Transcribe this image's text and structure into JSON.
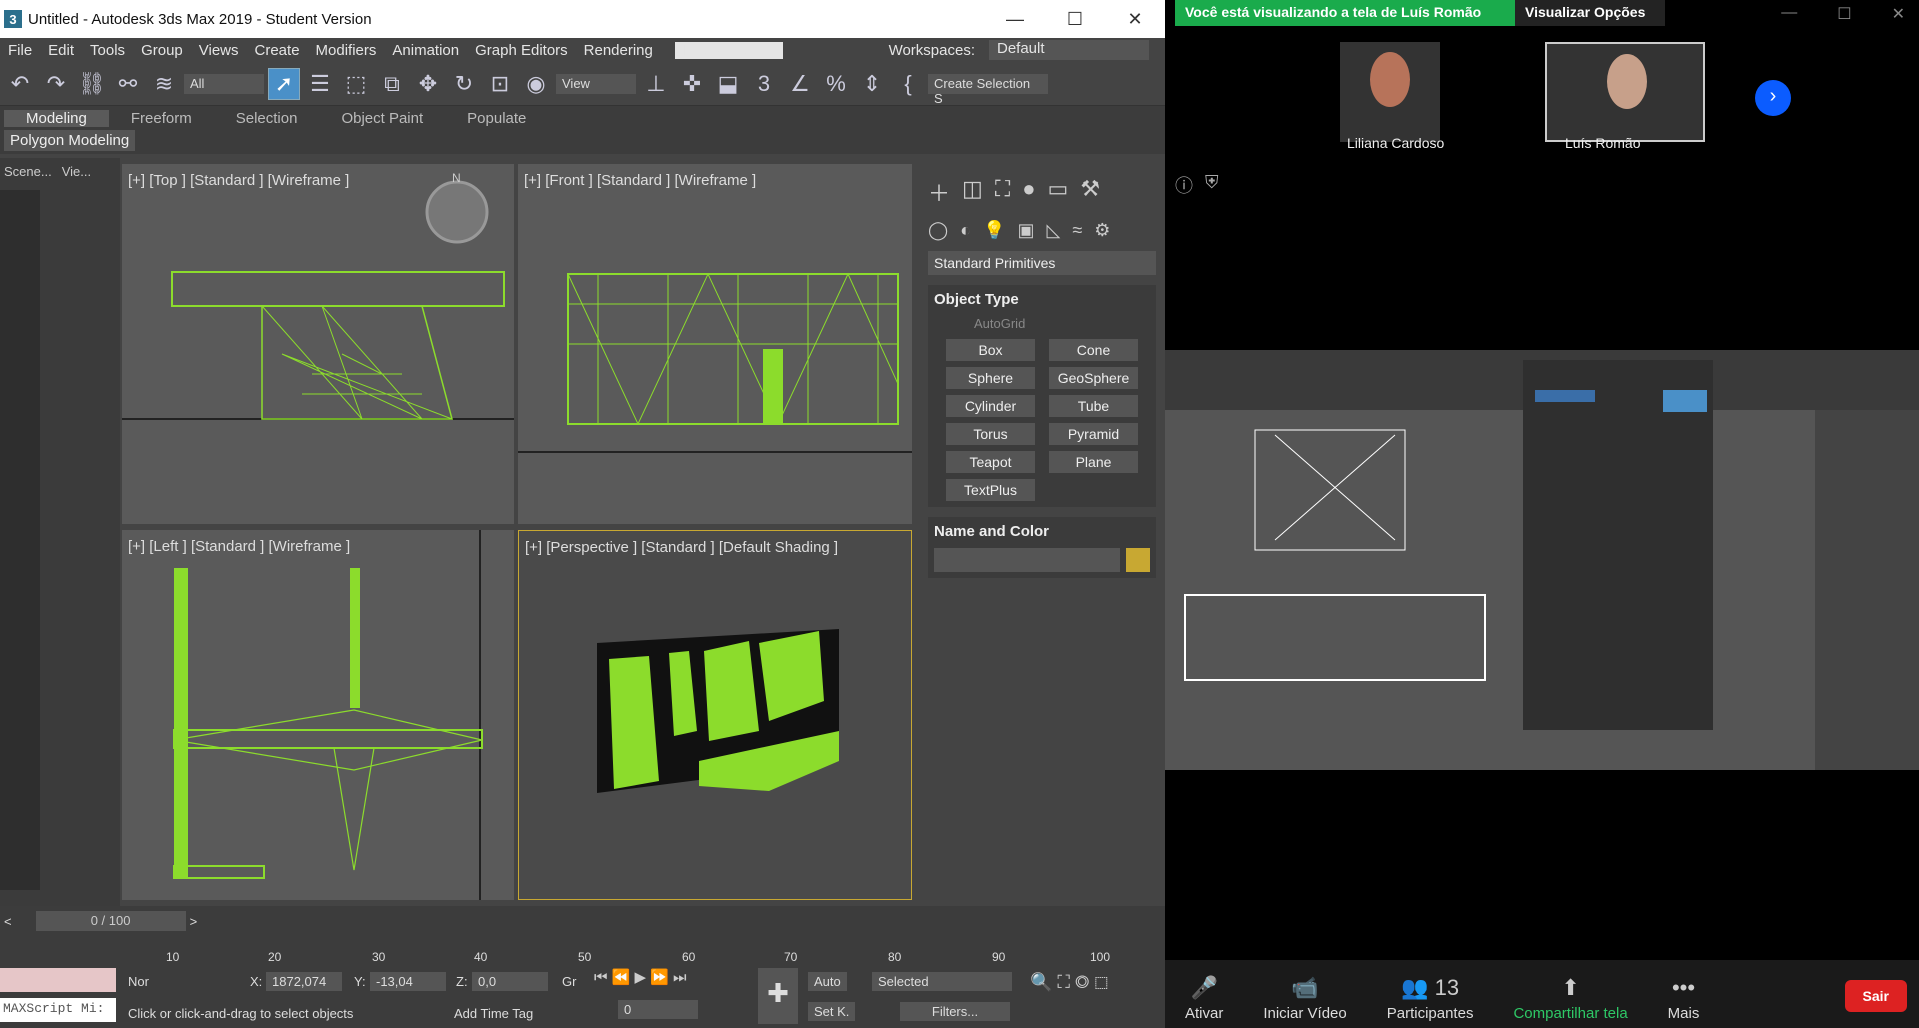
{
  "window": {
    "title": "Untitled - Autodesk 3ds Max 2019 - Student Version",
    "logo": "3"
  },
  "menu": [
    "File",
    "Edit",
    "Tools",
    "Group",
    "Views",
    "Create",
    "Modifiers",
    "Animation",
    "Graph Editors",
    "Rendering"
  ],
  "user": "Liliana Card...",
  "workspaces": {
    "label": "Workspaces:",
    "value": "Default"
  },
  "toolbar": {
    "filter": "All",
    "view": "View",
    "create_selection": "Create Selection S"
  },
  "ribbon": {
    "tabs": [
      "Modeling",
      "Freeform",
      "Selection",
      "Object Paint",
      "Populate"
    ],
    "sub": "Polygon Modeling"
  },
  "scene_tabs": [
    "Scene...",
    "Vie..."
  ],
  "viewports": {
    "top": "[+] [Top ] [Standard ] [Wireframe ]",
    "front": "[+] [Front ] [Standard ] [Wireframe ]",
    "left": "[+] [Left ] [Standard ] [Wireframe ]",
    "persp": "[+] [Perspective ] [Standard ] [Default Shading ]"
  },
  "command_panel": {
    "category": "Standard Primitives",
    "object_type": "Object Type",
    "autogrid": "AutoGrid",
    "buttons": [
      "Box",
      "Cone",
      "Sphere",
      "GeoSphere",
      "Cylinder",
      "Tube",
      "Torus",
      "Pyramid",
      "Teapot",
      "Plane",
      "TextPlus"
    ],
    "name_color": "Name and Color",
    "color": "#c8a832"
  },
  "timeline": {
    "slider": "0 / 100",
    "ticks": [
      "10",
      "20",
      "30",
      "40",
      "50",
      "60",
      "70",
      "80",
      "90",
      "100"
    ]
  },
  "status": {
    "script": "MAXScript Mi:",
    "nor": "Nor",
    "x_label": "X:",
    "x": "1872,074",
    "y_label": "Y:",
    "y": "-13,04",
    "z_label": "Z:",
    "z": "0,0",
    "gr": "Gr",
    "prompt": "Click or click-and-drag to select objects",
    "add_time_tag": "Add Time Tag",
    "auto": "Auto",
    "selected": "Selected",
    "setk": "Set K.",
    "filters": "Filters...",
    "frame": "0"
  },
  "zoom": {
    "banner": "Você está visualizando a tela de Luís Romão",
    "view_options": "Visualizar Opções",
    "participants": [
      "Liliana Cardoso",
      "Luís Romão"
    ],
    "count": "13",
    "bar": [
      "Ativar",
      "Iniciar Vídeo",
      "Participantes",
      "Compartilhar tela",
      "Mais"
    ],
    "leave": "Sair"
  }
}
